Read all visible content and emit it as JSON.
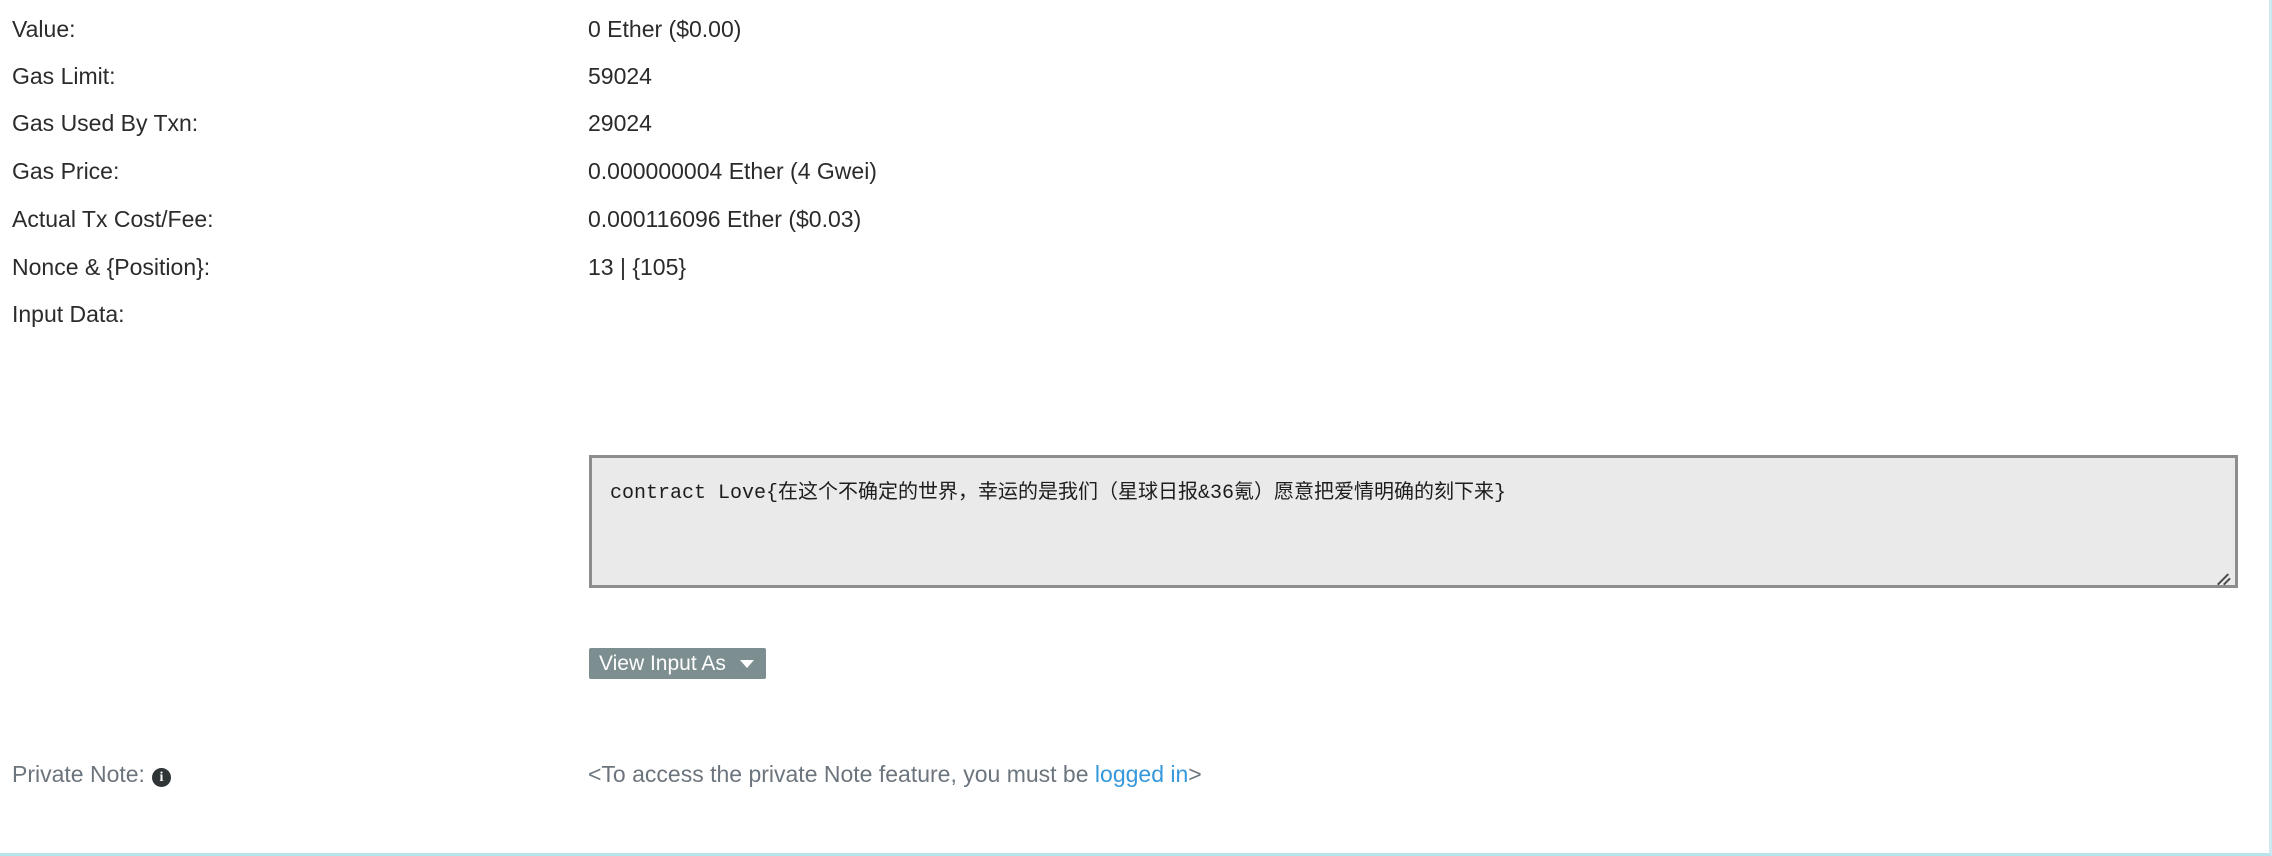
{
  "panel": {
    "accent_border_color": "#b8e4ee",
    "rows": [
      {
        "label": "Value:",
        "value": "0 Ether ($0.00)"
      },
      {
        "label": "Gas Limit:",
        "value": "59024"
      },
      {
        "label": "Gas Used By Txn:",
        "value": "29024"
      },
      {
        "label": "Gas Price:",
        "value": "0.000000004 Ether (4 Gwei)"
      },
      {
        "label": "Actual Tx Cost/Fee:",
        "value": "0.000116096 Ether ($0.03)"
      },
      {
        "label": "Nonce & {Position}:",
        "value": "13 | {105}"
      },
      {
        "label": "Input Data:",
        "value": ""
      }
    ]
  },
  "input_data": {
    "label": "Input Data:",
    "content": "contract Love{在这个不确定的世界，幸运的是我们（星球日报&36氪）愿意把爱情明确的刻下来}",
    "view_as_button_label": "View Input As",
    "caret_icon": "chevron-down-icon",
    "resize_grip_icon": "resize-grip-icon",
    "button_color": "#7d8e91",
    "textarea_background": "#eaeaea",
    "textarea_border": "#8d8d8d"
  },
  "private_note": {
    "label": "Private Note:",
    "info_icon": "info-icon",
    "info_icon_glyph": "i",
    "text_before": "<To access the private Note feature, you must be ",
    "link_label": "logged in",
    "text_after": ">",
    "link_color": "#3498db"
  }
}
